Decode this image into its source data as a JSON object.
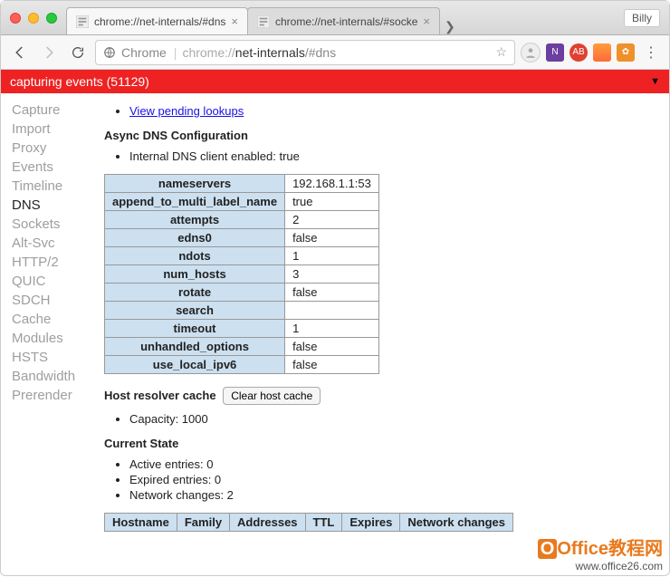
{
  "browser": {
    "profile_name": "Billy",
    "tabs": [
      {
        "title": "chrome://net-internals/#dns",
        "active": true
      },
      {
        "title": "chrome://net-internals/#socke",
        "active": false
      }
    ],
    "url_label": "Chrome",
    "url_scheme": "chrome://",
    "url_host": "net-internals",
    "url_path": "/#dns"
  },
  "capture_bar": {
    "text": "capturing events (51129)",
    "toggle": "▼"
  },
  "sidebar": {
    "items": [
      "Capture",
      "Import",
      "Proxy",
      "Events",
      "Timeline",
      "DNS",
      "Sockets",
      "Alt-Svc",
      "HTTP/2",
      "QUIC",
      "SDCH",
      "Cache",
      "Modules",
      "HSTS",
      "Bandwidth",
      "Prerender"
    ],
    "active": "DNS"
  },
  "main": {
    "pending_link": "View pending lookups",
    "async_heading": "Async DNS Configuration",
    "internal_client": "Internal DNS client enabled: true",
    "config_rows": [
      {
        "k": "nameservers",
        "v": "192.168.1.1:53"
      },
      {
        "k": "append_to_multi_label_name",
        "v": "true"
      },
      {
        "k": "attempts",
        "v": "2"
      },
      {
        "k": "edns0",
        "v": "false"
      },
      {
        "k": "ndots",
        "v": "1"
      },
      {
        "k": "num_hosts",
        "v": "3"
      },
      {
        "k": "rotate",
        "v": "false"
      },
      {
        "k": "search",
        "v": ""
      },
      {
        "k": "timeout",
        "v": "1"
      },
      {
        "k": "unhandled_options",
        "v": "false"
      },
      {
        "k": "use_local_ipv6",
        "v": "false"
      }
    ],
    "resolver_heading": "Host resolver cache",
    "clear_btn": "Clear host cache",
    "capacity": "Capacity: 1000",
    "current_state": "Current State",
    "state_items": [
      "Active entries: 0",
      "Expired entries: 0",
      "Network changes: 2"
    ],
    "table_headers": [
      "Hostname",
      "Family",
      "Addresses",
      "TTL",
      "Expires",
      "Network changes"
    ]
  },
  "watermark": {
    "line1": "Office教程网",
    "line2": "www.office26.com"
  }
}
